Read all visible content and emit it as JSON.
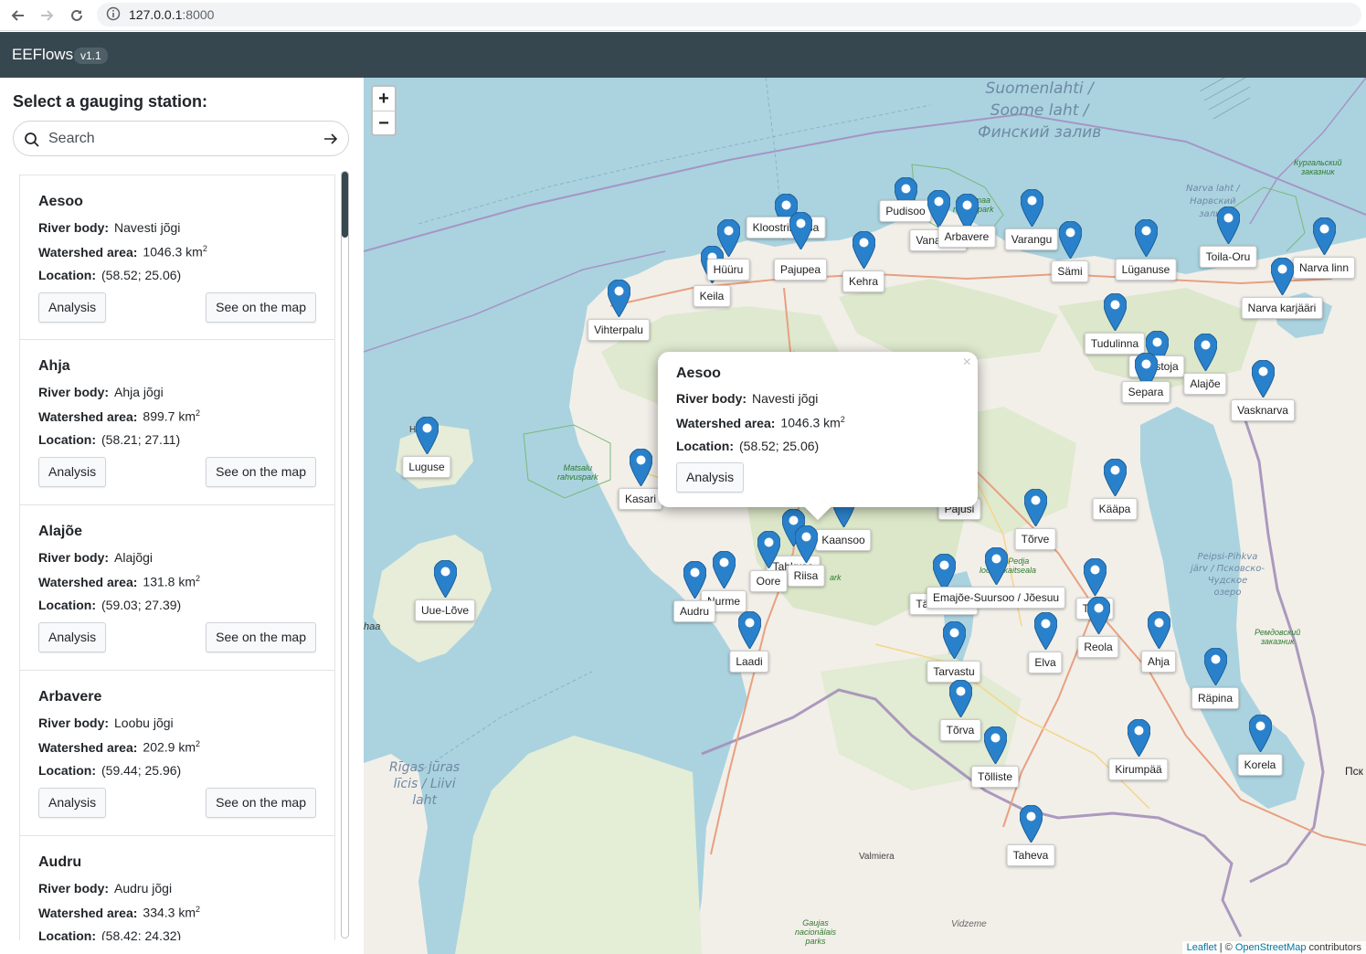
{
  "browser": {
    "url_host": "127.0.0.1",
    "url_port": ":8000"
  },
  "app": {
    "brand": "EEFlows",
    "version": "v1.1"
  },
  "sidebar": {
    "title": "Select a gauging station:",
    "search_placeholder": "Search",
    "labels": {
      "river_body": "River body:",
      "watershed_area": "Watershed area:",
      "location": "Location:",
      "area_unit": "km",
      "area_unit_exp": "2"
    },
    "stations": [
      {
        "name": "Aesoo",
        "river": "Navesti jõgi",
        "area": "1046.3",
        "location": "(58.52; 25.06)"
      },
      {
        "name": "Ahja",
        "river": "Ahja jõgi",
        "area": "899.7",
        "location": "(58.21; 27.11)"
      },
      {
        "name": "Alajõe",
        "river": "Alajõgi",
        "area": "131.8",
        "location": "(59.03; 27.39)"
      },
      {
        "name": "Arbavere",
        "river": "Loobu jõgi",
        "area": "202.9",
        "location": "(59.44; 25.96)"
      },
      {
        "name": "Audru",
        "river": "Audru jõgi",
        "area": "334.3",
        "location": "(58.42; 24.32)"
      }
    ],
    "analysis_label": "Analysis",
    "see_map_label": "See on the map"
  },
  "map": {
    "zoom_in": "+",
    "zoom_out": "−",
    "sea_labels": {
      "gulf_finland": [
        "Suomenlahti /",
        "Soome laht /",
        "Финский залив"
      ],
      "gulf_riga": [
        "Rīgas jūras",
        "līcis / Liivi",
        "laht"
      ],
      "narva_bay": [
        "Narva laht /",
        "Нарвский",
        "залив"
      ],
      "peipsi": [
        "Peipsi-Pihkva",
        "järv / Псковско-",
        "Чудское",
        "озеро"
      ]
    },
    "park_labels": {
      "lahemaa": [
        "Lahemaa",
        "rahvuspark"
      ],
      "matsalu": [
        "Matsalu",
        "rahvuspark"
      ],
      "kurgal": [
        "Кургальский",
        "заказник"
      ],
      "remdov": [
        "Ремдовский",
        "заказник"
      ],
      "gauja": [
        "Gaujas",
        "nacionālais",
        "parks"
      ],
      "soomaa": "ark",
      "alam_pedja": [
        "Alam-Pedja",
        "looduskaitseala"
      ]
    },
    "city_labels": {
      "valmiera": "Valmiera",
      "vidzeme": "Vidzeme",
      "pskov": "Пск",
      "haa": "haa",
      "hi": "Hi"
    },
    "markers": [
      {
        "name": "Vihterpalu"
      },
      {
        "name": "Keila"
      },
      {
        "name": "Hüüru"
      },
      {
        "name": "Kloostrimetsa"
      },
      {
        "name": "Pajupea"
      },
      {
        "name": "Kehra"
      },
      {
        "name": "Pudisoo"
      },
      {
        "name": "Vanaküla"
      },
      {
        "name": "Arbavere"
      },
      {
        "name": "Varangu"
      },
      {
        "name": "Sämi"
      },
      {
        "name": "Lüganuse"
      },
      {
        "name": "Toila-Oru"
      },
      {
        "name": "Narva linn"
      },
      {
        "name": "Narva karjääri"
      },
      {
        "name": "Tudulinna"
      },
      {
        "name": "Roostoja"
      },
      {
        "name": "Separa"
      },
      {
        "name": "Alajõe"
      },
      {
        "name": "Vasknarva"
      },
      {
        "name": "Luguse"
      },
      {
        "name": "Kasari"
      },
      {
        "name": "Pajusi"
      },
      {
        "name": "Kääpa"
      },
      {
        "name": "Tõrve"
      },
      {
        "name": "Kaansoo"
      },
      {
        "name": "Tahkuse"
      },
      {
        "name": "Riisa"
      },
      {
        "name": "Oore"
      },
      {
        "name": "Nurme"
      },
      {
        "name": "Audru"
      },
      {
        "name": "Uue-Lõve"
      },
      {
        "name": "Laadi"
      },
      {
        "name": "Tänassilma"
      },
      {
        "name": "Emajõe-Suursoo / Jõesuu"
      },
      {
        "name": "Tartu"
      },
      {
        "name": "Reola"
      },
      {
        "name": "Ahja"
      },
      {
        "name": "Elva"
      },
      {
        "name": "Tarvastu"
      },
      {
        "name": "Räpina"
      },
      {
        "name": "Tõrva"
      },
      {
        "name": "Tõlliste"
      },
      {
        "name": "Kirumpää"
      },
      {
        "name": "Korela"
      },
      {
        "name": "Taheva"
      }
    ],
    "popup": {
      "close": "×",
      "name": "Aesoo",
      "river_label": "River body:",
      "river": "Navesti jõgi",
      "area_label": "Watershed area:",
      "area": "1046.3 km",
      "area_exp": "2",
      "location_label": "Location:",
      "location": "(58.52; 25.06)",
      "analysis": "Analysis"
    },
    "attribution": {
      "leaflet": "Leaflet",
      "sep": " | © ",
      "osm": "OpenStreetMap",
      "contrib": " contributors"
    }
  },
  "colors": {
    "navbar": "#37474f",
    "water": "#aad3df",
    "land": "#f2efe9",
    "marker": "#2a81cb"
  }
}
